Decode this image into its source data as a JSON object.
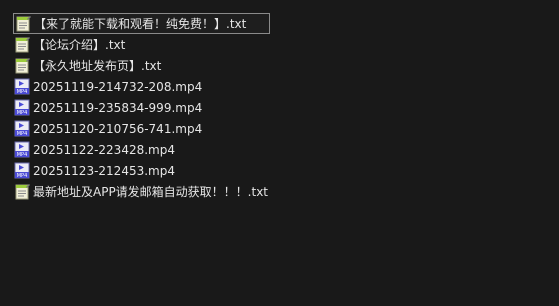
{
  "files": [
    {
      "name": "【来了就能下载和观看！纯免费！】.txt",
      "type": "txt",
      "icon": "notepad-icon",
      "selected": true
    },
    {
      "name": "【论坛介绍】.txt",
      "type": "txt",
      "icon": "notepad-icon",
      "selected": false
    },
    {
      "name": "【永久地址发布页】.txt",
      "type": "txt",
      "icon": "notepad-icon",
      "selected": false
    },
    {
      "name": "20251119-214732-208.mp4",
      "type": "mp4",
      "icon": "video-file-icon",
      "selected": false
    },
    {
      "name": "20251119-235834-999.mp4",
      "type": "mp4",
      "icon": "video-file-icon",
      "selected": false
    },
    {
      "name": "20251120-210756-741.mp4",
      "type": "mp4",
      "icon": "video-file-icon",
      "selected": false
    },
    {
      "name": "20251122-223428.mp4",
      "type": "mp4",
      "icon": "video-file-icon",
      "selected": false
    },
    {
      "name": "20251123-212453.mp4",
      "type": "mp4",
      "icon": "video-file-icon",
      "selected": false
    },
    {
      "name": "最新地址及APP请发邮箱自动获取！！！.txt",
      "type": "txt",
      "icon": "notepad-icon",
      "selected": false
    }
  ],
  "icon_labels": {
    "mp4": "MP4"
  },
  "colors": {
    "background": "#191919",
    "text": "#e6e6e6",
    "selection_border": "#8a8a8a",
    "mp4_icon": "#4b4bd6",
    "notepad_icon": "#9ccc3c"
  }
}
